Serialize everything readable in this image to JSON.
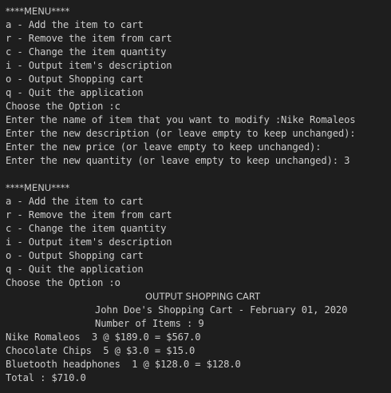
{
  "terminal": {
    "menu1": {
      "title": "****MENU****",
      "items": [
        "a - Add the item to cart",
        "r - Remove the item from cart",
        "c - Change the item quantity",
        "i - Output item's description",
        "o - Output Shopping cart",
        "q - Quit the application"
      ],
      "prompt": "Choose the Option :c"
    },
    "modify": {
      "name_prompt": "Enter the name of item that you want to modify :Nike Romaleos",
      "description_prompt": "Enter the new description (or leave empty to keep unchanged):",
      "price_prompt": "Enter the new price (or leave empty to keep unchanged):",
      "quantity_prompt": "Enter the new quantity (or leave empty to keep unchanged): 3"
    },
    "menu2": {
      "title": "****MENU****",
      "items": [
        "a - Add the item to cart",
        "r - Remove the item from cart",
        "c - Change the item quantity",
        "i - Output item's description",
        "o - Output Shopping cart",
        "q - Quit the application"
      ],
      "prompt": "Choose the Option :o"
    },
    "cart": {
      "heading": "OUTPUT SHOPPING CART",
      "owner_line": "John Doe's Shopping Cart - February 01, 2020",
      "count_line": "Number of Items : 9",
      "items": [
        "Nike Romaleos  3 @ $189.0 = $567.0",
        "Chocolate Chips  5 @ $3.0 = $15.0",
        "Bluetooth headphones  1 @ $128.0 = $128.0"
      ],
      "total": "Total : $710.0"
    }
  }
}
